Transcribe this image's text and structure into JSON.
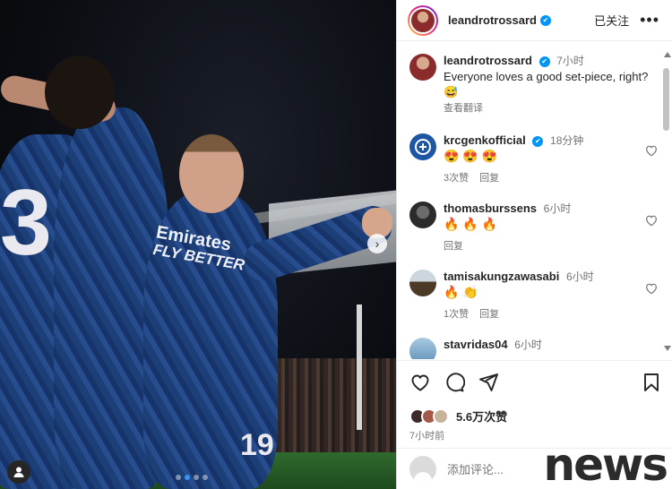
{
  "post": {
    "author": "leandrotrossard",
    "follow_label": "已关注",
    "more_label": "•••",
    "photo": {
      "jersey_number_left": "3",
      "jersey_number_bottom": "19",
      "sponsor_line1": "Emirates",
      "sponsor_line2": "FLY BETTER",
      "carousel_count": 4,
      "carousel_active": 1
    }
  },
  "caption": {
    "author": "leandrotrossard",
    "time": "7小时",
    "text": "Everyone loves a good set-piece, right? 😅",
    "translate": "查看翻译"
  },
  "comments": [
    {
      "user": "krcgenkofficial",
      "verified": true,
      "time": "18分钟",
      "text": "😍😍😍",
      "likes": "3次赞",
      "reply": "回复",
      "avatar_color": "#1e56a6"
    },
    {
      "user": "thomasburssens",
      "verified": false,
      "time": "6小时",
      "text": "🔥🔥🔥",
      "likes": "",
      "reply": "回复",
      "avatar_color": "#3a3a3a"
    },
    {
      "user": "tamisakungzawasabi",
      "verified": false,
      "time": "6小时",
      "text": "🔥👏",
      "likes": "1次赞",
      "reply": "回复",
      "avatar_color": "#5a4a2f"
    },
    {
      "user": "stavridas04",
      "verified": false,
      "time": "6小时",
      "text": "",
      "likes": "",
      "reply": "",
      "avatar_color": "#7fb1d6"
    }
  ],
  "stats": {
    "likes": "5.6万次赞",
    "posted": "7小时前",
    "liker_colors": [
      "#3c2a2a",
      "#a35a4a",
      "#c7b39c"
    ]
  },
  "add_comment": {
    "placeholder": "添加评论..."
  },
  "watermark": "news",
  "colors": {
    "verified": "#0095f6",
    "accent": "#3797f0",
    "muted": "#737373"
  }
}
